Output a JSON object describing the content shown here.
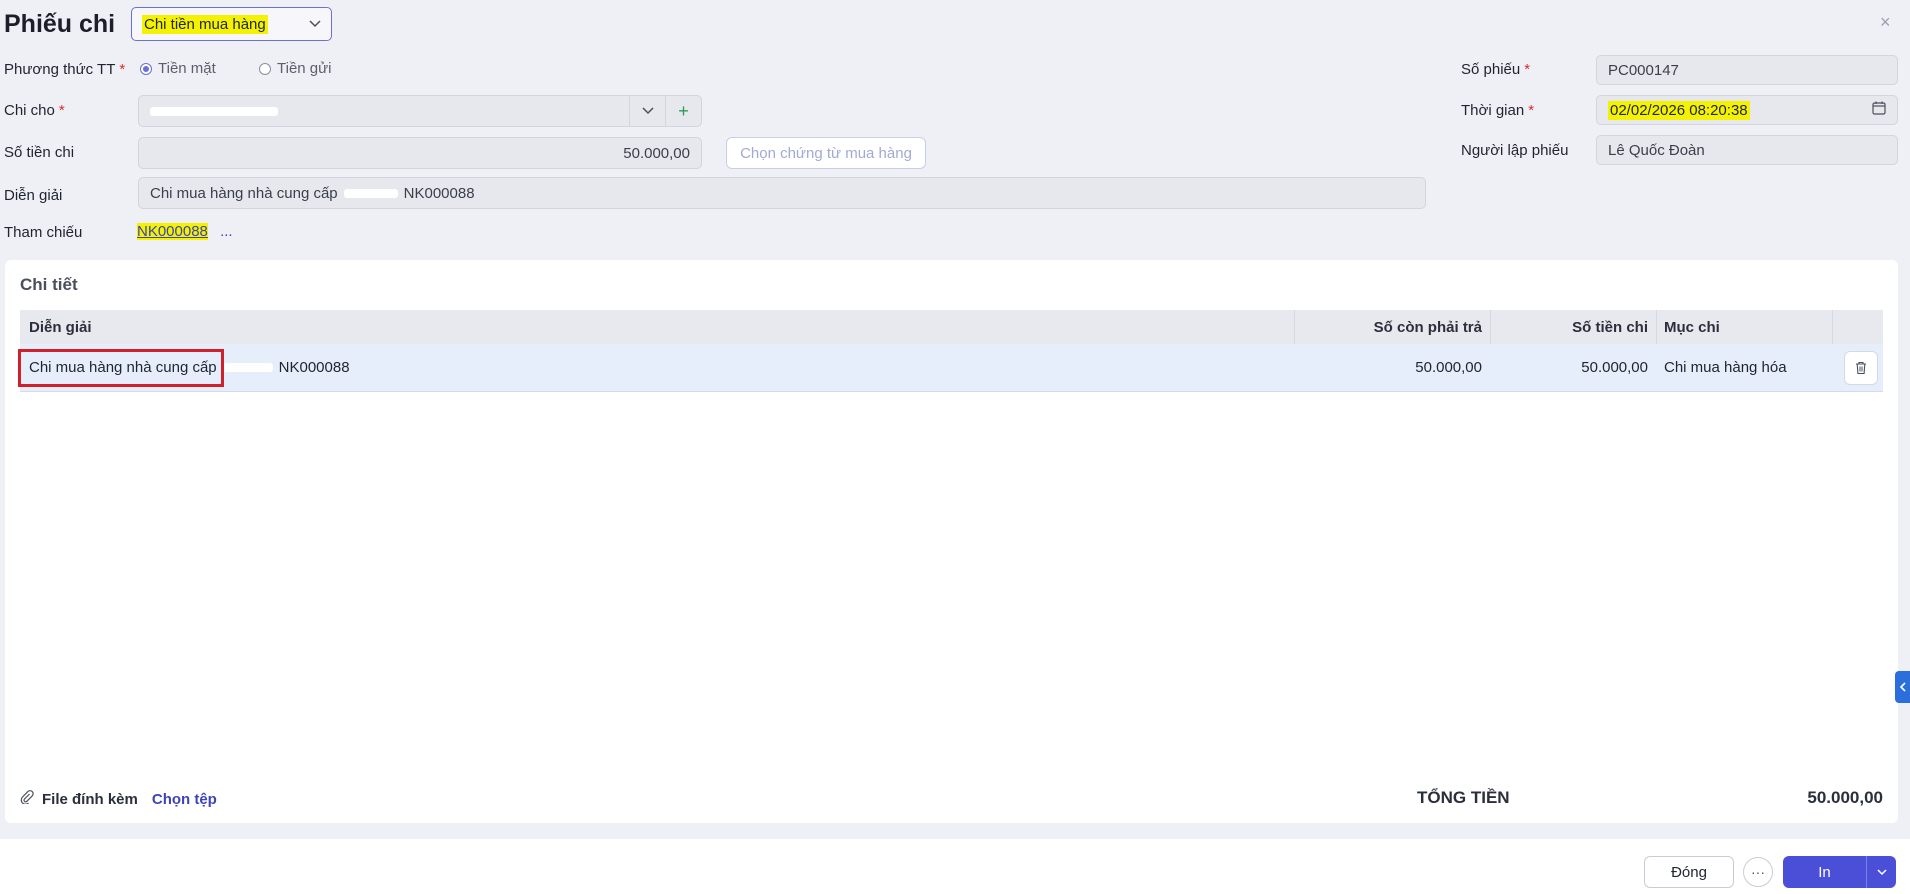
{
  "header": {
    "title": "Phiếu chi",
    "type_select_value": "Chi tiền mua hàng",
    "close_label": "×"
  },
  "form": {
    "payment_method": {
      "label": "Phương thức TT",
      "required": "*",
      "options": [
        "Tiền mặt",
        "Tiền gửi"
      ],
      "selected": "Tiền mặt"
    },
    "pay_to": {
      "label": "Chi cho",
      "required": "*",
      "add_label": "+"
    },
    "amount": {
      "label": "Số tiền chi",
      "value": "50.000,00"
    },
    "choose_purchase_doc_button": "Chọn chứng từ mua hàng",
    "description": {
      "label": "Diễn giải",
      "value_prefix": "Chi mua hàng nhà cung cấp",
      "value_suffix": "NK000088"
    },
    "reference": {
      "label": "Tham chiếu",
      "code": "NK000088",
      "more": "..."
    },
    "voucher_no": {
      "label": "Số phiếu",
      "required": "*",
      "value": "PC000147"
    },
    "time": {
      "label": "Thời gian",
      "required": "*",
      "value": "02/02/2026 08:20:38"
    },
    "creator": {
      "label": "Người lập phiếu",
      "value": "Lê Quốc Đoàn"
    }
  },
  "detail": {
    "title": "Chi tiết",
    "columns": [
      "Diễn giải",
      "Số còn phải trả",
      "Số tiền chi",
      "Mục chi"
    ],
    "rows": [
      {
        "description_prefix": "Chi mua hàng nhà cung cấp",
        "description_suffix": "NK000088",
        "remaining": "50.000,00",
        "amount": "50.000,00",
        "category": "Chi mua hàng hóa"
      }
    ],
    "attachment_label": "File đính kèm",
    "choose_file": "Chọn tệp",
    "total_label": "TỔNG TIỀN",
    "total_value": "50.000,00"
  },
  "footer": {
    "close_button": "Đóng",
    "more_button": "···",
    "print_button": "In"
  },
  "colors": {
    "accent": "#4b4fd8",
    "highlight": "#f4f200",
    "required": "#d92d2d",
    "selection_box": "#d0202c"
  }
}
